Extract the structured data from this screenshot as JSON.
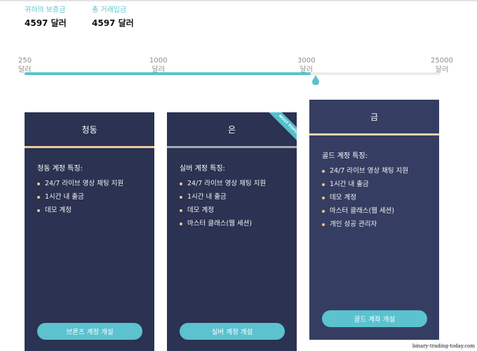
{
  "stats": [
    {
      "label": "귀하의 보증금",
      "value": "4597 달러"
    },
    {
      "label": "총 거래입금",
      "value": "4597 달러"
    }
  ],
  "slider": {
    "ticks": [
      {
        "amount": "250",
        "unit": "달러"
      },
      {
        "amount": "1000",
        "unit": "달러"
      },
      {
        "amount": "3000",
        "unit": "달러"
      },
      {
        "amount": "25000",
        "unit": "달러"
      }
    ],
    "fill_fraction": 0.69,
    "accent_color": "#5cc2cf"
  },
  "plans": {
    "bronze": {
      "title": "청동",
      "features_title": "청동 계정 특징:",
      "features": [
        "24/7 라이브 영상 채팅 지원",
        "1시간 내 출금",
        "데모 계정"
      ],
      "button_label": "브론즈 계정 개설"
    },
    "silver": {
      "title": "은",
      "ribbon": "MOST POPULAR",
      "features_title": "실버 계정 특징:",
      "features": [
        "24/7 라이브 영상 채팅 지원",
        "1시간 내 출금",
        "데모 계정",
        "마스터 클래스(웹 세션)"
      ],
      "button_label": "실버 계정 개설"
    },
    "gold": {
      "title": "금",
      "features_title": "골드 계정 특징:",
      "features": [
        "24/7 라이브 영상 채팅 지원",
        "1시간 내 출금",
        "데모 계정",
        "마스터 클래스(웹 세션)",
        "개인 성공 관리자"
      ],
      "button_label": "골드 계좌 개설"
    }
  },
  "colors": {
    "card_bg": "#2b3252",
    "card_bg_gold": "#353e62",
    "bronze_rule": "#f0c9a0",
    "silver_rule": "#a4a8b6",
    "bullet": "#f1c58e"
  },
  "watermark": "binary-trading-today.com"
}
